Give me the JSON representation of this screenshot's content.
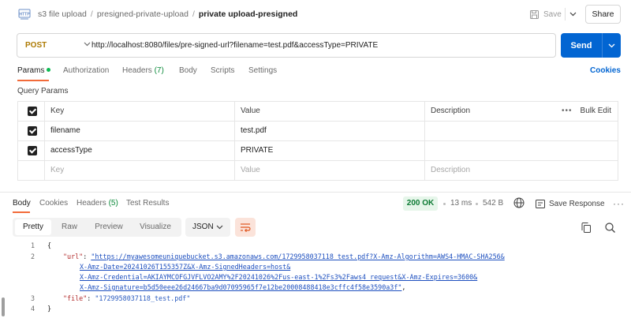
{
  "header": {
    "icon_label": "HTTP",
    "breadcrumb": [
      "s3 file upload",
      "presigned-private-upload"
    ],
    "title": "private upload-presigned",
    "save_label": "Save",
    "share_label": "Share"
  },
  "request": {
    "method": "POST",
    "url": "http://localhost:8080/files/pre-signed-url?filename=test.pdf&accessType=PRIVATE",
    "send_label": "Send"
  },
  "req_tabs": {
    "params": "Params",
    "authorization": "Authorization",
    "headers": "Headers",
    "headers_count": "(7)",
    "body": "Body",
    "scripts": "Scripts",
    "settings": "Settings",
    "cookies": "Cookies"
  },
  "query_params": {
    "title": "Query Params",
    "columns": {
      "key": "Key",
      "value": "Value",
      "description": "Description"
    },
    "bulk_edit": "Bulk Edit",
    "rows": [
      {
        "key": "filename",
        "value": "test.pdf",
        "description": ""
      },
      {
        "key": "accessType",
        "value": "PRIVATE",
        "description": ""
      }
    ],
    "placeholder": {
      "key": "Key",
      "value": "Value",
      "description": "Description"
    }
  },
  "response": {
    "tabs": {
      "body": "Body",
      "cookies": "Cookies",
      "headers": "Headers",
      "headers_count": "(5)",
      "test_results": "Test Results"
    },
    "status": "200 OK",
    "time": "13 ms",
    "size": "542 B",
    "save_response": "Save Response",
    "views": [
      "Pretty",
      "Raw",
      "Preview",
      "Visualize"
    ],
    "format": "JSON",
    "code": {
      "line_numbers": [
        "1",
        "2",
        "3",
        "4"
      ],
      "open_brace": "{",
      "close_brace": "}",
      "url_key": "\"url\"",
      "url_l1": "\"https://myawesomeuniquebucket.s3.amazonaws.com/1729958037118_test.pdf?X-Amz-Algorithm=AWS4-HMAC-SHA256&",
      "url_l2": "X-Amz-Date=20241026T155357Z&X-Amz-SignedHeaders=host&",
      "url_l3": "X-Amz-Credential=AKIAYMCOFGJVFLVO2AMY%2F20241026%2Fus-east-1%2Fs3%2Faws4_request&X-Amz-Expires=3600&",
      "url_l4": "X-Amz-Signature=b5d50eee26d24667ba9d07095965f7e12be20008488418e3cffc4f58e3590a3f\"",
      "file_key": "\"file\"",
      "file_val": "\"1729958037118_test.pdf\""
    }
  },
  "colors": {
    "accent": "#f26b3a",
    "send": "#0265d2",
    "method": "#ad7a03",
    "status_ok": "#0c7a33"
  }
}
